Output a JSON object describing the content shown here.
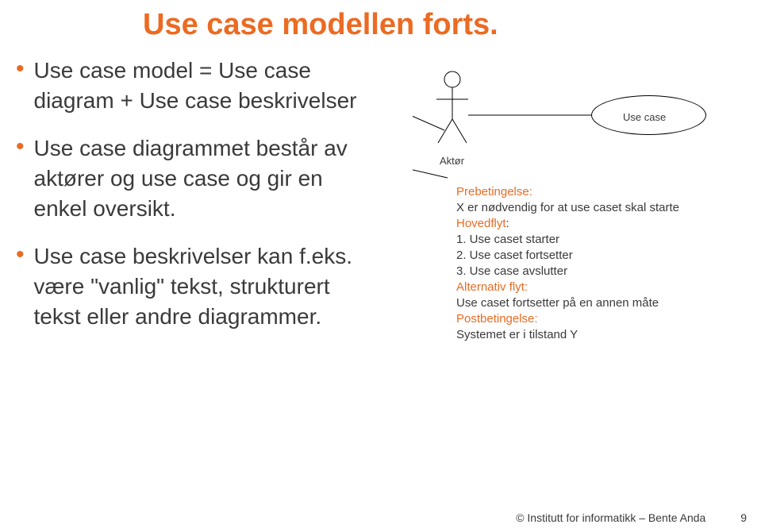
{
  "title": "Use case modellen forts.",
  "bullets": [
    "Use case model = Use case diagram + Use case beskrivelser",
    "Use case diagrammet består av aktører og use case og gir en enkel oversikt.",
    "Use case beskrivelser kan f.eks. være \"vanlig\" tekst, strukturert tekst eller andre diagrammer."
  ],
  "diagram": {
    "actor_label": "Aktør",
    "usecase_label": "Use case"
  },
  "description": {
    "pre_header": "Prebetingelse:",
    "pre_text": "X er nødvendig for at use caset skal starte",
    "hoved_header": "Hovedflyt",
    "hoved_colon": ":",
    "steps": [
      "1.        Use caset starter",
      "2.        Use caset fortsetter",
      "3.        Use case avslutter"
    ],
    "alt_header": "Alternativ flyt:",
    "alt_text": "Use caset fortsetter på en annen måte",
    "post_header": "Postbetingelse:",
    "post_text": "Systemet er i tilstand Y"
  },
  "footer": {
    "copyright": "© Institutt for informatikk – Bente Anda",
    "page": "9"
  }
}
